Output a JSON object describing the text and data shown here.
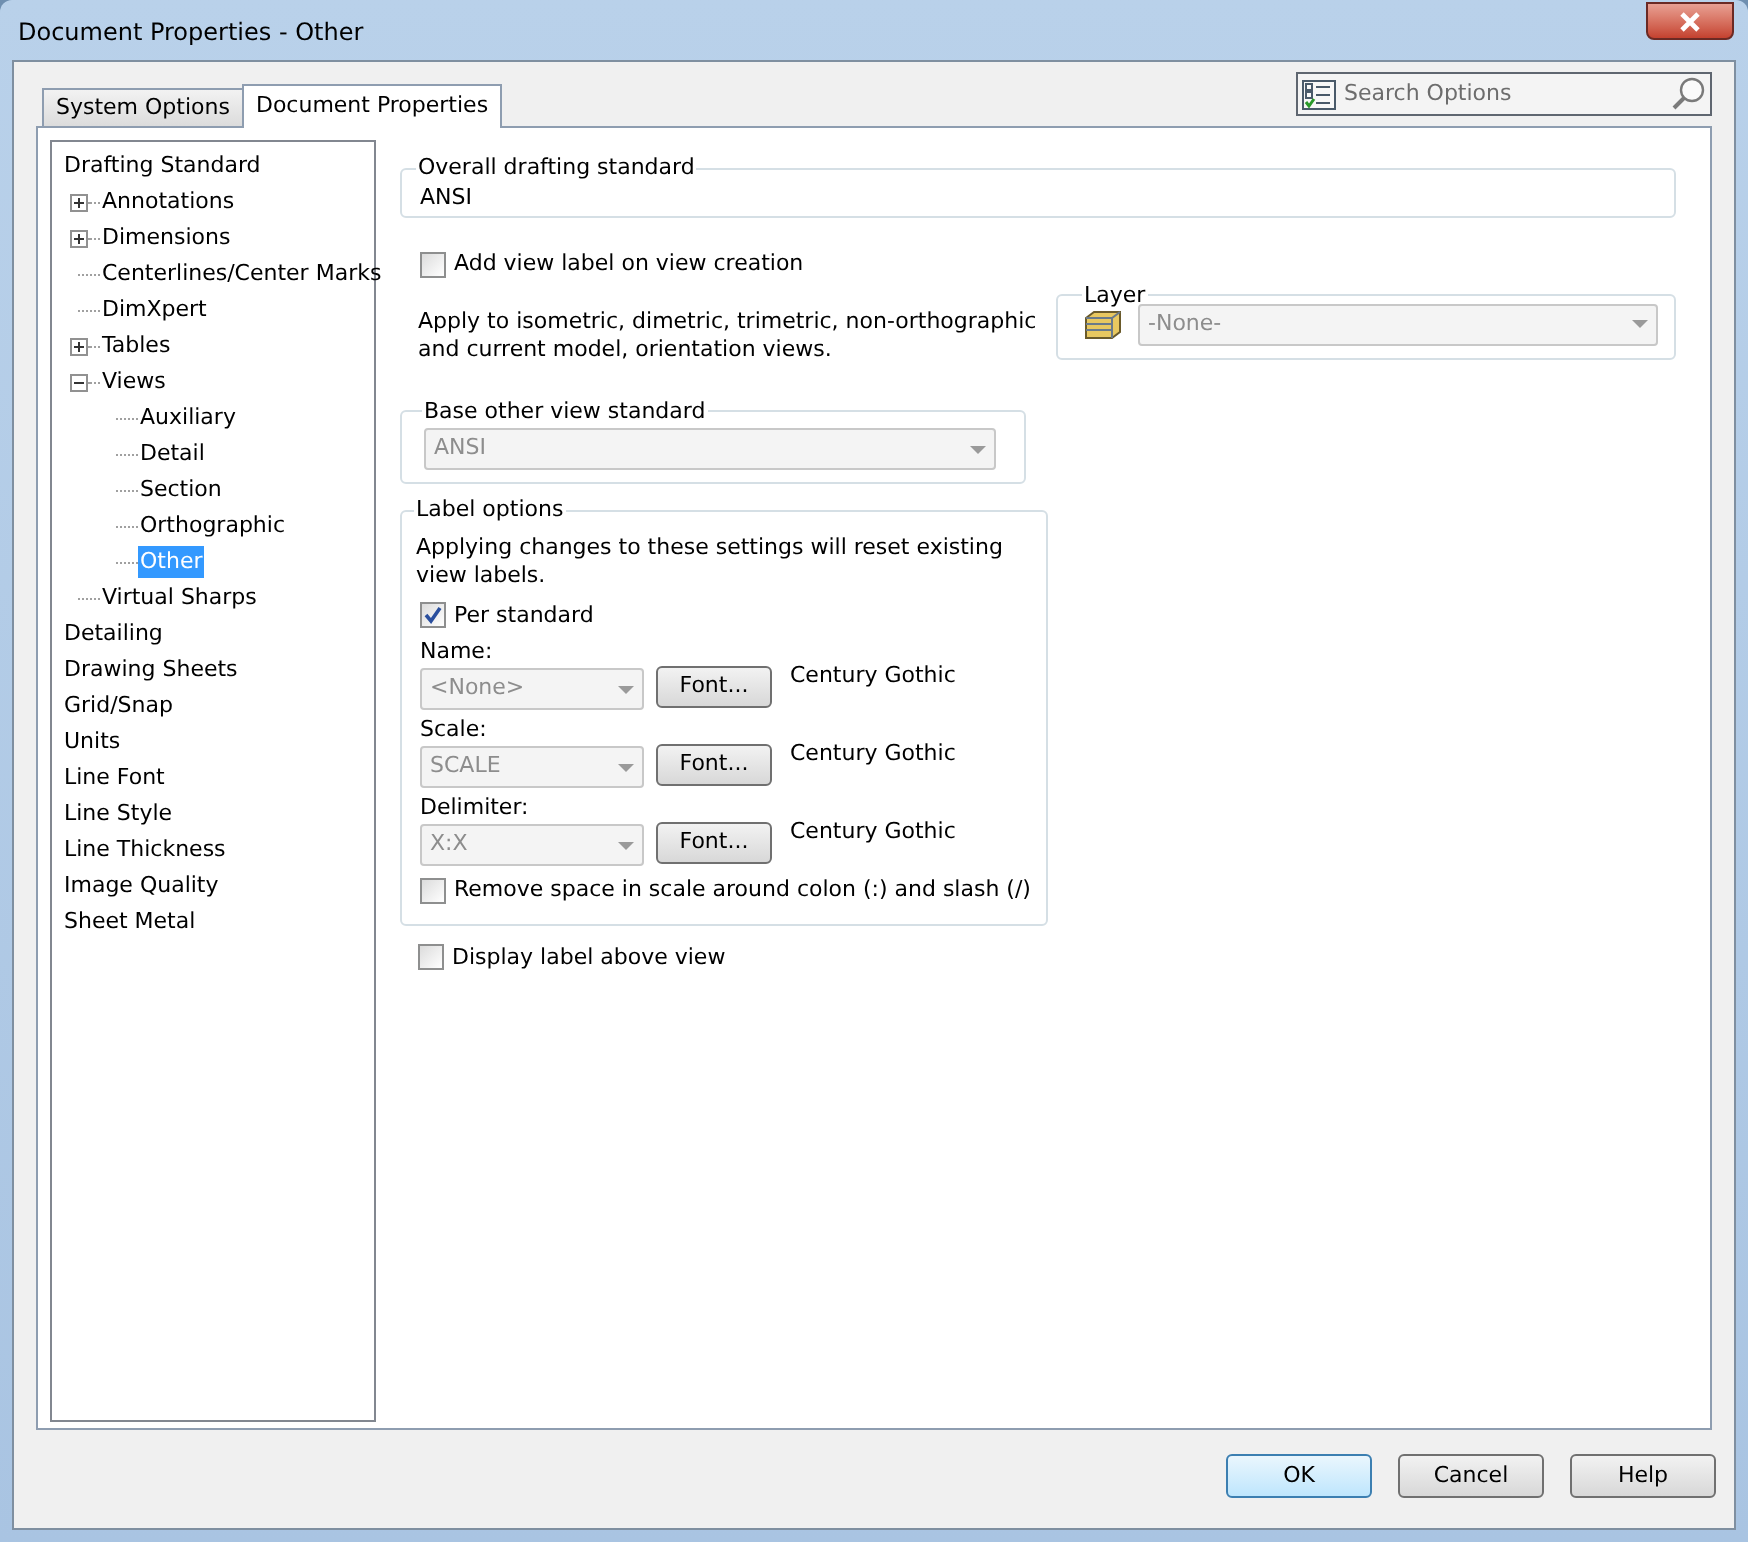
{
  "window": {
    "title": "Document Properties - Other"
  },
  "tabs": [
    {
      "label": "System Options",
      "selected": false
    },
    {
      "label": "Document Properties",
      "selected": true
    }
  ],
  "search": {
    "placeholder": "Search Options"
  },
  "tree": [
    {
      "label": "Drafting Standard",
      "selected": false,
      "children": [
        {
          "label": "Annotations",
          "expanded": false,
          "selected": false
        },
        {
          "label": "Dimensions",
          "expanded": false,
          "selected": false
        },
        {
          "label": "Centerlines/Center Marks",
          "selected": false
        },
        {
          "label": "DimXpert",
          "selected": false
        },
        {
          "label": "Tables",
          "expanded": false,
          "selected": false
        },
        {
          "label": "Views",
          "expanded": true,
          "selected": false,
          "children": [
            {
              "label": "Auxiliary",
              "selected": false
            },
            {
              "label": "Detail",
              "selected": false
            },
            {
              "label": "Section",
              "selected": false
            },
            {
              "label": "Orthographic",
              "selected": false
            },
            {
              "label": "Other",
              "selected": true
            }
          ]
        },
        {
          "label": "Virtual Sharps",
          "selected": false
        }
      ]
    },
    {
      "label": "Detailing",
      "selected": false
    },
    {
      "label": "Drawing Sheets",
      "selected": false
    },
    {
      "label": "Grid/Snap",
      "selected": false
    },
    {
      "label": "Units",
      "selected": false
    },
    {
      "label": "Line Font",
      "selected": false
    },
    {
      "label": "Line Style",
      "selected": false
    },
    {
      "label": "Line Thickness",
      "selected": false
    },
    {
      "label": "Image Quality",
      "selected": false
    },
    {
      "label": "Sheet Metal",
      "selected": false
    }
  ],
  "overall_drafting_standard": {
    "label": "Overall drafting standard",
    "value": "ANSI"
  },
  "add_view_label": {
    "label": "Add view label on view creation",
    "checked": false
  },
  "apply_note": "Apply to isometric, dimetric, trimetric, non-orthographic and current model, orientation views.",
  "layer": {
    "label": "Layer",
    "value": "-None-",
    "disabled": true
  },
  "base_view_standard": {
    "label": "Base other view standard",
    "value": "ANSI",
    "disabled": true
  },
  "label_options": {
    "label": "Label options",
    "note": "Applying changes to these settings will reset existing view labels.",
    "per_standard": {
      "label": "Per standard",
      "checked": true
    },
    "fields": [
      {
        "label": "Name:",
        "value": "<None>",
        "button": "Font...",
        "font": "Century Gothic",
        "disabled": true
      },
      {
        "label": "Scale:",
        "value": "SCALE",
        "button": "Font...",
        "font": "Century Gothic",
        "disabled": true
      },
      {
        "label": "Delimiter:",
        "value": "X:X",
        "button": "Font...",
        "font": "Century Gothic",
        "disabled": true
      }
    ],
    "remove_space": {
      "label": "Remove space in scale around colon (:) and slash (/)",
      "checked": false
    }
  },
  "display_label_above": {
    "label": "Display label above view",
    "checked": false
  },
  "buttons": [
    {
      "label": "OK",
      "default": true
    },
    {
      "label": "Cancel",
      "default": false
    },
    {
      "label": "Help",
      "default": false
    }
  ]
}
